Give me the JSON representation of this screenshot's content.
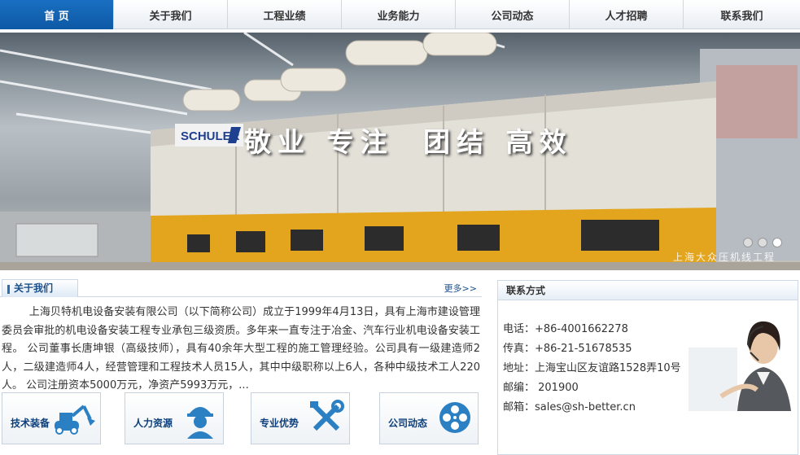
{
  "nav": {
    "items": [
      {
        "label": "首 页",
        "active": true
      },
      {
        "label": "关于我们"
      },
      {
        "label": "工程业绩"
      },
      {
        "label": "业务能力"
      },
      {
        "label": "公司动态"
      },
      {
        "label": "人才招聘"
      },
      {
        "label": "联系我们"
      }
    ]
  },
  "banner": {
    "brand": "SCHULER",
    "slogan_left": "敬业 专注",
    "slogan_right": "团结 高效",
    "caption": "上海大众压机线工程",
    "slide_count": 3,
    "active_slide": 3
  },
  "about": {
    "title": "关于我们",
    "more": "更多>>",
    "text": "上海贝特机电设备安装有限公司（以下简称公司）成立于1999年4月13日，具有上海市建设管理委员会审批的机电设备安装工程专业承包三级资质。多年来一直专注于冶金、汽车行业机电设备安装工程。 公司董事长唐坤银（高级技师），具有40余年大型工程的施工管理经验。公司具有一级建造师2人，二级建造师4人，经营管理和工程技术人员15人，其中中级职称以上6人，各种中级技术工人220人。 公司注册资本5000万元，净资产5993万元，..."
  },
  "boxes": [
    {
      "label": "技术装备",
      "icon": "excavator-icon"
    },
    {
      "label": "人力资源",
      "icon": "worker-icon"
    },
    {
      "label": "专业优势",
      "icon": "tools-icon"
    },
    {
      "label": "公司动态",
      "icon": "film-reel-icon"
    }
  ],
  "contact": {
    "title": "联系方式",
    "phone": "电话：+86-4001662278",
    "fax": "传真：+86-21-51678535",
    "address": "地址：上海宝山区友谊路1528弄10号",
    "postcode": "邮编： 201900",
    "email": "邮箱：sales@sh-better.cn"
  },
  "colors": {
    "nav_active": "#1565b5",
    "brand_blue": "#0d3f7a",
    "icon_blue": "#2b7fc3"
  }
}
